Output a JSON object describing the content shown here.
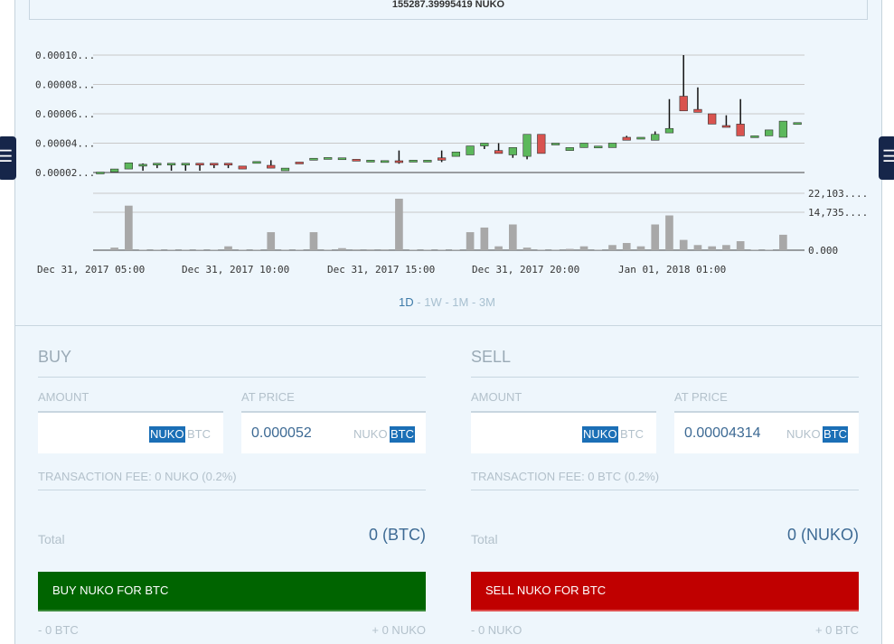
{
  "balance_text": "155287.39995419 NUKO",
  "chart_data": {
    "type": "candlestick",
    "x_tick_labels": [
      "Dec 31, 2017 05:00",
      "Dec 31, 2017 10:00",
      "Dec 31, 2017 15:00",
      "Dec 31, 2017 20:00",
      "Jan 01, 2018 01:00"
    ],
    "y_tick_labels": [
      "0.00002...",
      "0.00004...",
      "0.00006...",
      "0.00008...",
      "0.00010..."
    ],
    "y_ticks": [
      2e-05,
      4e-05,
      6e-05,
      8e-05,
      0.0001
    ],
    "ylim": [
      2e-05,
      0.0001
    ],
    "volume_tick_labels": [
      "22,103....",
      "14,735....",
      "0.000"
    ],
    "volume_ticks": [
      22103,
      14735,
      0
    ],
    "volume_ylim": [
      0,
      22103
    ],
    "grid": true,
    "up_color": "#5cb85c",
    "down_color": "#d9534f",
    "volume_color": "#a8a8a8",
    "candles": [
      {
        "o": 2.02e-05,
        "h": 2.03e-05,
        "l": 2.01e-05,
        "c": 2.03e-05,
        "v": 0
      },
      {
        "o": 2.04e-05,
        "h": 2.24e-05,
        "l": 2.04e-05,
        "c": 2.24e-05,
        "v": 1000
      },
      {
        "o": 2.24e-05,
        "h": 2.66e-05,
        "l": 2.24e-05,
        "c": 2.66e-05,
        "v": 17300
      },
      {
        "o": 2.53e-05,
        "h": 2.62e-05,
        "l": 2.12e-05,
        "c": 2.56e-05,
        "v": 200
      },
      {
        "o": 2.53e-05,
        "h": 2.63e-05,
        "l": 2.3e-05,
        "c": 2.63e-05,
        "v": 200
      },
      {
        "o": 2.53e-05,
        "h": 2.63e-05,
        "l": 2.12e-05,
        "c": 2.63e-05,
        "v": 200
      },
      {
        "o": 2.53e-05,
        "h": 2.63e-05,
        "l": 2.12e-05,
        "c": 2.63e-05,
        "v": 200
      },
      {
        "o": 2.63e-05,
        "h": 2.63e-05,
        "l": 2.12e-05,
        "c": 2.53e-05,
        "v": 200
      },
      {
        "o": 2.63e-05,
        "h": 2.63e-05,
        "l": 2.3e-05,
        "c": 2.53e-05,
        "v": 200
      },
      {
        "o": 2.63e-05,
        "h": 2.63e-05,
        "l": 2.3e-05,
        "c": 2.53e-05,
        "v": 1500
      },
      {
        "o": 2.44e-05,
        "h": 2.44e-05,
        "l": 2.24e-05,
        "c": 2.24e-05,
        "v": 200
      },
      {
        "o": 2.63e-05,
        "h": 2.75e-05,
        "l": 2.63e-05,
        "c": 2.75e-05,
        "v": 200
      },
      {
        "o": 2.49e-05,
        "h": 2.84e-05,
        "l": 2.3e-05,
        "c": 2.3e-05,
        "v": 7000
      },
      {
        "o": 2.12e-05,
        "h": 2.3e-05,
        "l": 2.12e-05,
        "c": 2.3e-05,
        "v": 200
      },
      {
        "o": 2.71e-05,
        "h": 2.71e-05,
        "l": 2.6e-05,
        "c": 2.6e-05,
        "v": 200
      },
      {
        "o": 2.84e-05,
        "h": 2.97e-05,
        "l": 2.84e-05,
        "c": 2.97e-05,
        "v": 7000
      },
      {
        "o": 2.92e-05,
        "h": 3.02e-05,
        "l": 2.92e-05,
        "c": 3.02e-05,
        "v": 200
      },
      {
        "o": 2.92e-05,
        "h": 3e-05,
        "l": 2.92e-05,
        "c": 3e-05,
        "v": 800
      },
      {
        "o": 2.9e-05,
        "h": 2.9e-05,
        "l": 2.8e-05,
        "c": 2.8e-05,
        "v": 300
      },
      {
        "o": 2.71e-05,
        "h": 2.84e-05,
        "l": 2.71e-05,
        "c": 2.84e-05,
        "v": 300
      },
      {
        "o": 2.71e-05,
        "h": 2.81e-05,
        "l": 2.71e-05,
        "c": 2.81e-05,
        "v": 300
      },
      {
        "o": 2.8e-05,
        "h": 3.5e-05,
        "l": 2.6e-05,
        "c": 2.71e-05,
        "v": 20000
      },
      {
        "o": 2.71e-05,
        "h": 2.84e-05,
        "l": 2.71e-05,
        "c": 2.84e-05,
        "v": 200
      },
      {
        "o": 2.71e-05,
        "h": 2.84e-05,
        "l": 2.71e-05,
        "c": 2.84e-05,
        "v": 200
      },
      {
        "o": 3e-05,
        "h": 3.5e-05,
        "l": 2.71e-05,
        "c": 2.84e-05,
        "v": 200
      },
      {
        "o": 3.1e-05,
        "h": 3.4e-05,
        "l": 3.1e-05,
        "c": 3.4e-05,
        "v": 200
      },
      {
        "o": 3.2e-05,
        "h": 3.81e-05,
        "l": 3.2e-05,
        "c": 3.81e-05,
        "v": 7000
      },
      {
        "o": 3.81e-05,
        "h": 4e-05,
        "l": 3.6e-05,
        "c": 4e-05,
        "v": 8800
      },
      {
        "o": 3.5e-05,
        "h": 4e-05,
        "l": 3.3e-05,
        "c": 3.3e-05,
        "v": 1500
      },
      {
        "o": 3.2e-05,
        "h": 3.7e-05,
        "l": 3e-05,
        "c": 3.7e-05,
        "v": 10000
      },
      {
        "o": 3.1e-05,
        "h": 4.6e-05,
        "l": 2.9e-05,
        "c": 4.6e-05,
        "v": 1000
      },
      {
        "o": 4.6e-05,
        "h": 4.6e-05,
        "l": 3.3e-05,
        "c": 3.3e-05,
        "v": 200
      },
      {
        "o": 3.9e-05,
        "h": 4e-05,
        "l": 3.9e-05,
        "c": 4e-05,
        "v": 200
      },
      {
        "o": 3.5e-05,
        "h": 3.7e-05,
        "l": 3.5e-05,
        "c": 3.7e-05,
        "v": 500
      },
      {
        "o": 3.7e-05,
        "h": 4e-05,
        "l": 3.7e-05,
        "c": 4e-05,
        "v": 1500
      },
      {
        "o": 3.7e-05,
        "h": 3.8e-05,
        "l": 3.7e-05,
        "c": 3.8e-05,
        "v": 200
      },
      {
        "o": 3.7e-05,
        "h": 4e-05,
        "l": 3.7e-05,
        "c": 4e-05,
        "v": 2000
      },
      {
        "o": 4.4e-05,
        "h": 4.5e-05,
        "l": 4.2e-05,
        "c": 4.2e-05,
        "v": 2800
      },
      {
        "o": 4.3e-05,
        "h": 4.4e-05,
        "l": 4.3e-05,
        "c": 4.4e-05,
        "v": 1500
      },
      {
        "o": 4.2e-05,
        "h": 4.8e-05,
        "l": 4.2e-05,
        "c": 4.6e-05,
        "v": 10000
      },
      {
        "o": 4.7e-05,
        "h": 7e-05,
        "l": 4.7e-05,
        "c": 5e-05,
        "v": 13500
      },
      {
        "o": 7.2e-05,
        "h": 0.0001,
        "l": 6.2e-05,
        "c": 6.2e-05,
        "v": 4000
      },
      {
        "o": 6.3e-05,
        "h": 7.8e-05,
        "l": 6.1e-05,
        "c": 6.1e-05,
        "v": 2000
      },
      {
        "o": 6e-05,
        "h": 6e-05,
        "l": 5.3e-05,
        "c": 5.3e-05,
        "v": 1500
      },
      {
        "o": 5.2e-05,
        "h": 5.9e-05,
        "l": 5.1e-05,
        "c": 5.1e-05,
        "v": 2000
      },
      {
        "o": 5.3e-05,
        "h": 7e-05,
        "l": 4.5e-05,
        "c": 4.5e-05,
        "v": 3500
      },
      {
        "o": 4.4e-05,
        "h": 4.5e-05,
        "l": 4.4e-05,
        "c": 4.5e-05,
        "v": 200
      },
      {
        "o": 4.5e-05,
        "h": 4.9e-05,
        "l": 4.5e-05,
        "c": 4.9e-05,
        "v": 200
      },
      {
        "o": 4.4e-05,
        "h": 5.5e-05,
        "l": 4.4e-05,
        "c": 5.5e-05,
        "v": 6000
      },
      {
        "o": 5.3e-05,
        "h": 5.4e-05,
        "l": 5.3e-05,
        "c": 5.4e-05,
        "v": 0
      }
    ]
  },
  "range": {
    "d1": "1D",
    "sep": " - ",
    "w1": "1W",
    "m1": "1M",
    "m3": "3M"
  },
  "buy": {
    "title": "BUY",
    "amount_label": "AMOUNT",
    "price_label": "AT PRICE",
    "amount_value": "",
    "price_value": "0.000052",
    "cur_nuko": "NUKO",
    "cur_btc": "BTC",
    "fee": "TRANSACTION FEE: 0 NUKO (0.2%)",
    "total_label": "Total",
    "total_value": "0 (BTC)",
    "button": "BUY NUKO FOR BTC",
    "summary_left": "- 0 BTC",
    "summary_right": "+ 0 NUKO"
  },
  "sell": {
    "title": "SELL",
    "amount_label": "AMOUNT",
    "price_label": "AT PRICE",
    "amount_value": "",
    "price_value": "0.00004314",
    "cur_nuko": "NUKO",
    "cur_btc": "BTC",
    "fee": "TRANSACTION FEE: 0 BTC (0.2%)",
    "total_label": "Total",
    "total_value": "0 (NUKO)",
    "button": "SELL NUKO FOR BTC",
    "summary_left": "- 0 NUKO",
    "summary_right": "+ 0 BTC"
  }
}
